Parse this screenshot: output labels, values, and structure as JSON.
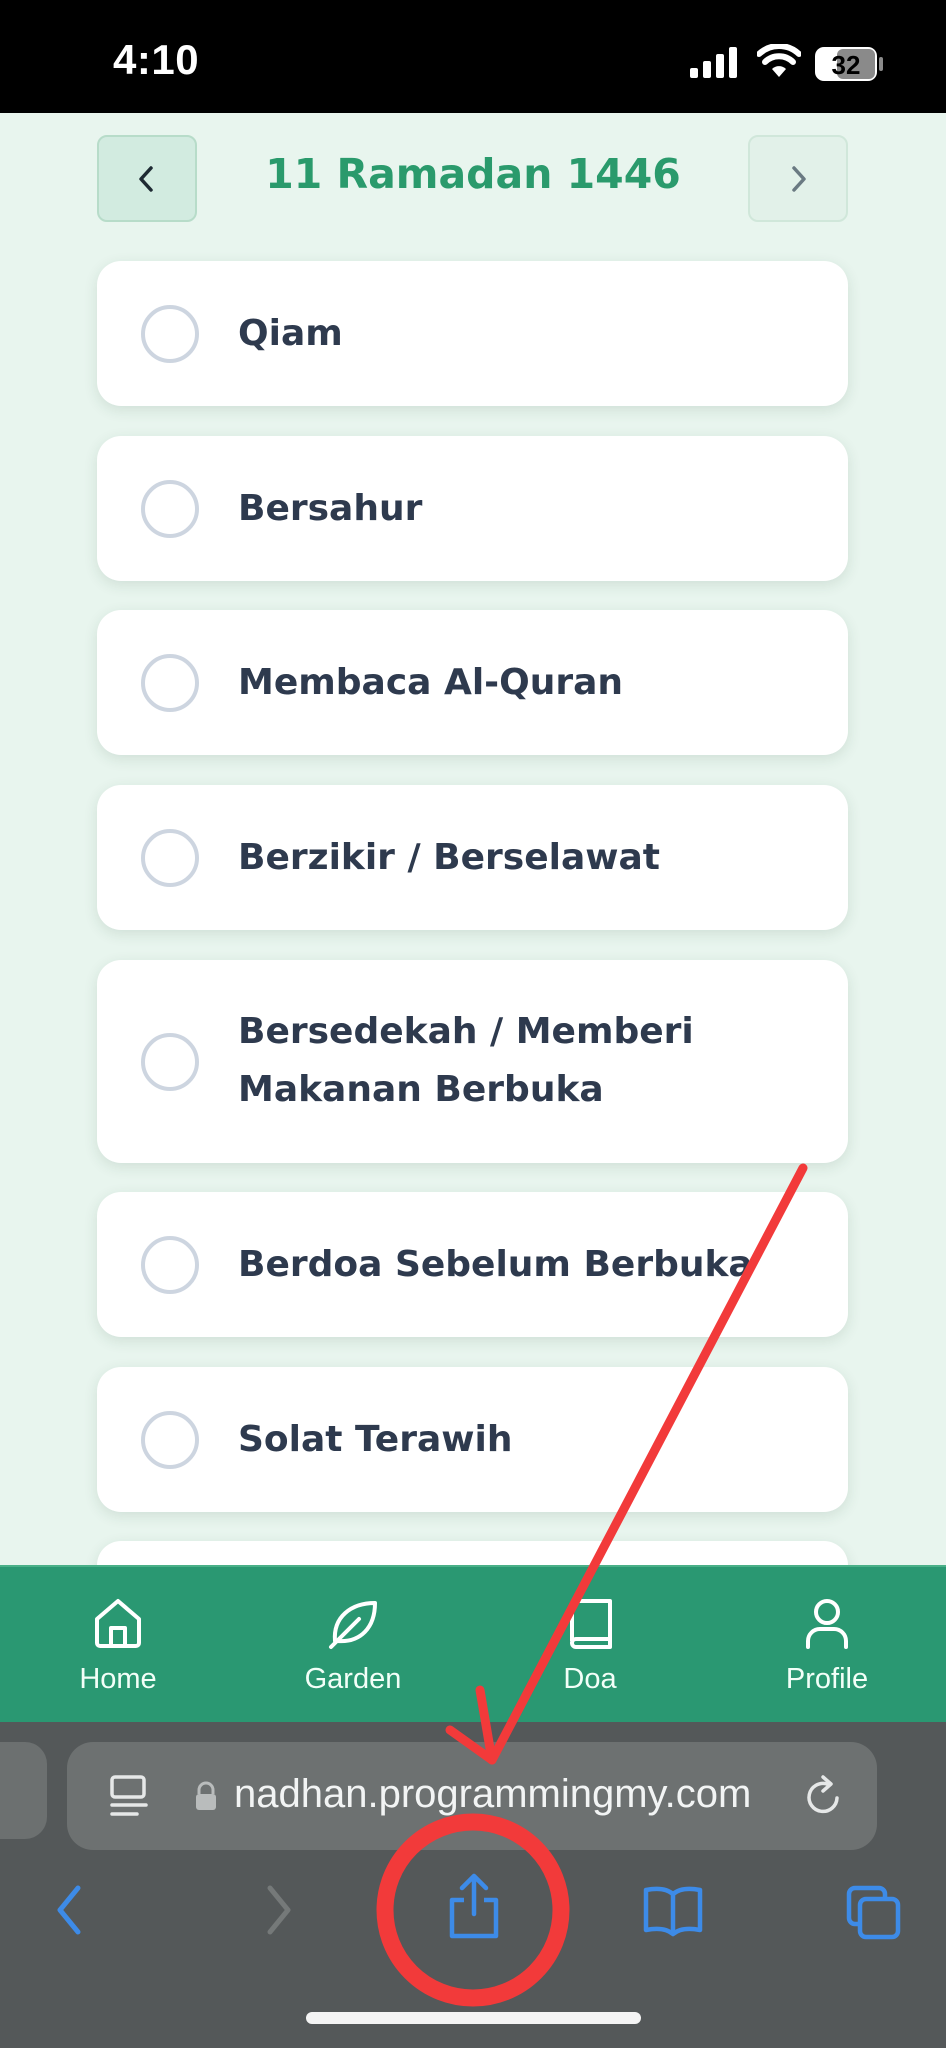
{
  "status_bar": {
    "time": "4:10",
    "battery": "32"
  },
  "date_nav": {
    "title": "11 Ramadan 1446",
    "prev_icon": "chevron-left-icon",
    "next_icon": "chevron-right-icon"
  },
  "tasks": [
    {
      "label": "Qiam",
      "checked": false
    },
    {
      "label": "Bersahur",
      "checked": false
    },
    {
      "label": "Membaca Al-Quran",
      "checked": false
    },
    {
      "label": "Berzikir / Berselawat",
      "checked": false
    },
    {
      "label": "Bersedekah / Memberi Makanan Berbuka",
      "checked": false
    },
    {
      "label": "Berdoa Sebelum Berbuka",
      "checked": false
    },
    {
      "label": "Solat Terawih",
      "checked": false
    }
  ],
  "app_nav": [
    {
      "label": "Home",
      "icon": "home-icon"
    },
    {
      "label": "Garden",
      "icon": "leaf-icon"
    },
    {
      "label": "Doa",
      "icon": "book-icon"
    },
    {
      "label": "Profile",
      "icon": "user-icon"
    }
  ],
  "browser": {
    "url": "nadhan.programmingmy.com",
    "toolbar": [
      "back-icon",
      "forward-icon",
      "share-icon",
      "bookmarks-icon",
      "tabs-icon"
    ]
  },
  "colors": {
    "accent": "#2a9a6c",
    "nav_bar": "#2a9872",
    "page_bg": "#e8f5ee",
    "annotation": "#f23a3a",
    "browser_blue": "#3d8be8"
  }
}
